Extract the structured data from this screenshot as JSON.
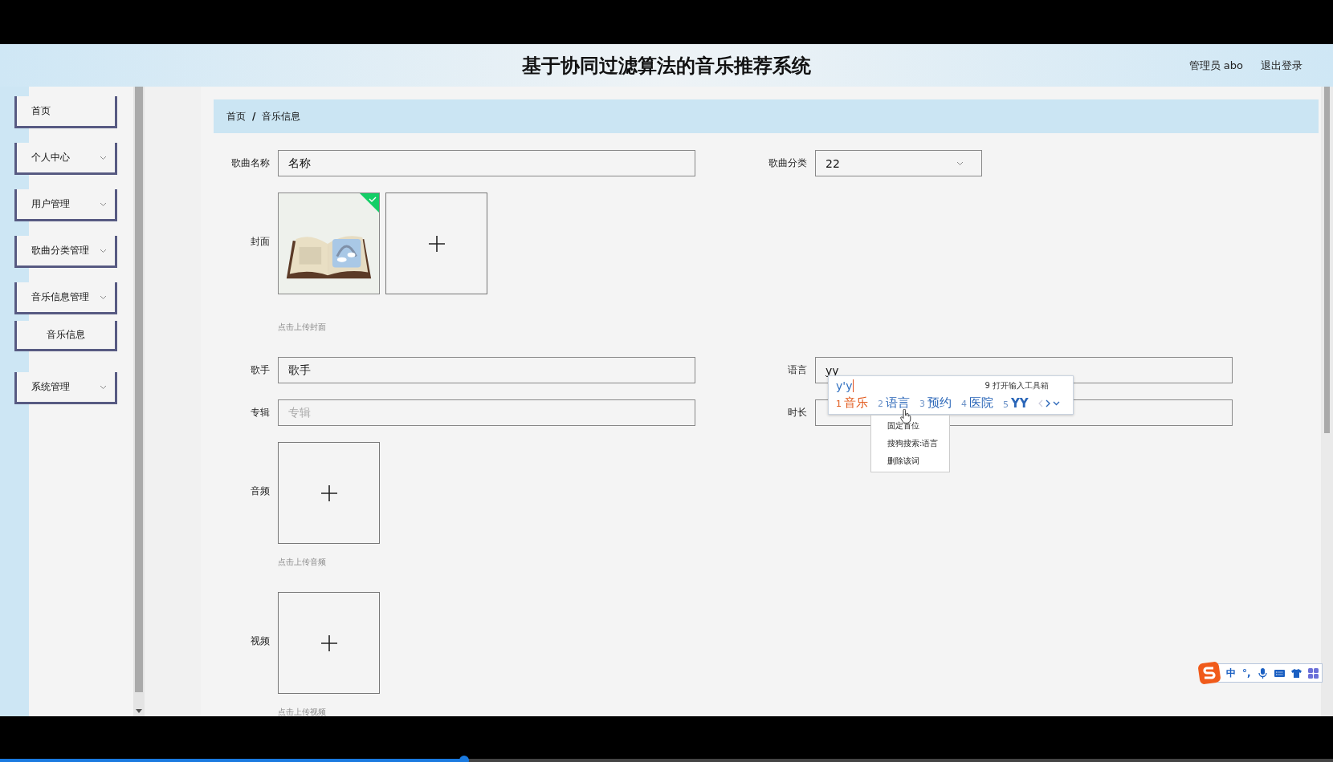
{
  "header": {
    "title": "基于协同过滤算法的音乐推荐系统",
    "user": "管理员 abo",
    "logout": "退出登录"
  },
  "sidebar": {
    "items": [
      {
        "kind": "link",
        "label": "首页"
      },
      {
        "kind": "group",
        "label": "个人中心"
      },
      {
        "kind": "group",
        "label": "用户管理"
      },
      {
        "kind": "group",
        "label": "歌曲分类管理"
      },
      {
        "kind": "group",
        "label": "音乐信息管理",
        "children": [
          {
            "label": "音乐信息"
          }
        ]
      },
      {
        "kind": "group",
        "label": "系统管理"
      }
    ]
  },
  "breadcrumb": {
    "separator": "/",
    "items": [
      "首页",
      "音乐信息"
    ]
  },
  "form": {
    "rows": [
      [
        {
          "kind": "text",
          "label": "歌曲名称",
          "value": "名称"
        },
        {
          "kind": "select",
          "label": "歌曲分类",
          "value": "22"
        }
      ],
      [
        {
          "kind": "upload",
          "label": "封面",
          "files": [
            {
              "kind": "picture",
              "uploaded": true
            }
          ],
          "hint": "点击上传封面"
        }
      ],
      [
        {
          "kind": "text",
          "label": "歌手",
          "value": "歌手"
        },
        {
          "kind": "text",
          "label": "语言",
          "value": "yy",
          "composing": true
        }
      ],
      [
        {
          "kind": "text",
          "label": "专辑",
          "placeholder": "专辑"
        },
        {
          "kind": "text",
          "label": "时长"
        }
      ],
      [
        {
          "kind": "upload",
          "label": "音频",
          "hint": "点击上传音频"
        }
      ],
      [
        {
          "kind": "upload",
          "label": "视频",
          "hint": "点击上传视频"
        }
      ]
    ]
  },
  "ime": {
    "composition": "y'y",
    "toolbox": "9 打开输入工具箱",
    "candidates": [
      {
        "number": "1",
        "text": "音乐",
        "selected": true
      },
      {
        "number": "2",
        "text": "语言",
        "selected": false
      },
      {
        "number": "3",
        "text": "预约",
        "selected": false
      },
      {
        "number": "4",
        "text": "医院",
        "selected": false
      },
      {
        "number": "5",
        "text": "YY",
        "selected": false
      }
    ],
    "context_menu": [
      "固定首位",
      "搜狗搜索:语言",
      "删除该词"
    ],
    "status_bar": {
      "mode": "中",
      "punctuation": "°,"
    }
  },
  "video_progress": {
    "level": 0.348
  }
}
